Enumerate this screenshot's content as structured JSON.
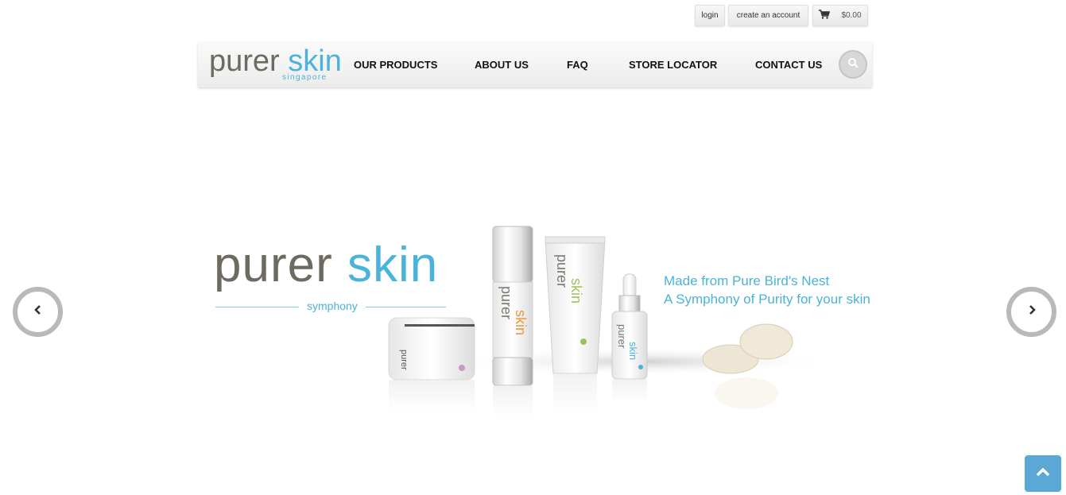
{
  "utility": {
    "login": "login",
    "create_account": "create an account",
    "cart_total": "$0.00"
  },
  "brand": {
    "name_part1": "purer",
    "name_part2": "skin",
    "region": "singapore"
  },
  "nav": {
    "products": "OUR PRODUCTS",
    "about": "ABOUT US",
    "faq": "FAQ",
    "store": "STORE LOCATOR",
    "contact": "CONTACT US"
  },
  "hero": {
    "logo_part1": "purer",
    "logo_part2": "skin",
    "sub": "symphony",
    "tagline_line1": "Made from Pure Bird's Nest",
    "tagline_line2": "A Symphony of Purity for your skin",
    "product_text_a": "purer",
    "product_text_b": "skin"
  },
  "icons": {
    "cart": "cart-icon",
    "search": "search-icon",
    "prev": "chevron-left-icon",
    "next": "chevron-right-icon",
    "top": "chevron-up-icon"
  },
  "colors": {
    "brand_blue": "#4bb3d9",
    "brand_grey": "#6d6a60",
    "back_to_top": "#5aa8d6"
  }
}
